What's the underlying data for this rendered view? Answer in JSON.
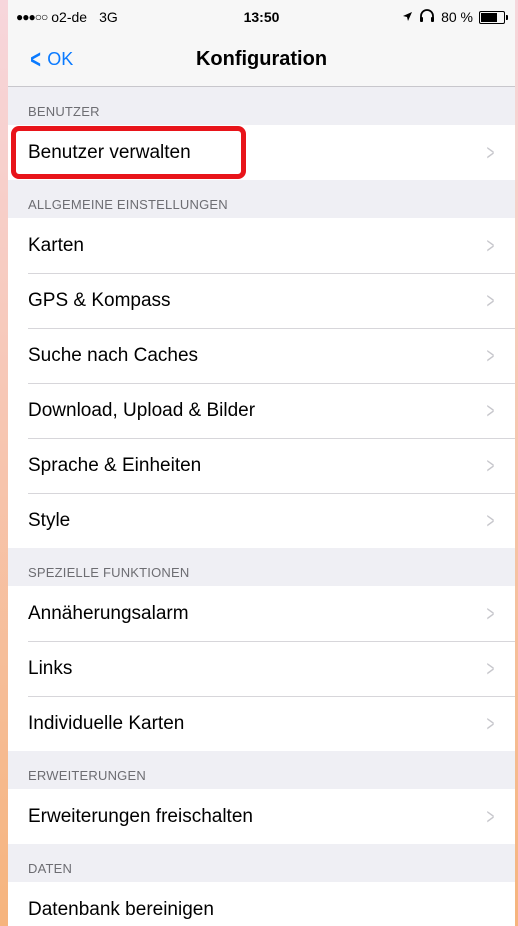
{
  "status_bar": {
    "signal_dots": "●●●○○",
    "carrier": "o2-de",
    "network": "3G",
    "time": "13:50",
    "location_icon": "location-arrow-icon",
    "headphones_icon": "headphones-icon",
    "battery_percent": "80 %",
    "battery_level": 0.8
  },
  "nav": {
    "back_label": "OK",
    "title": "Konfiguration"
  },
  "sections": [
    {
      "header": "BENUTZER",
      "items": [
        "Benutzer verwalten"
      ]
    },
    {
      "header": "ALLGEMEINE EINSTELLUNGEN",
      "items": [
        "Karten",
        "GPS & Kompass",
        "Suche nach Caches",
        "Download, Upload & Bilder",
        "Sprache & Einheiten",
        "Style"
      ]
    },
    {
      "header": "SPEZIELLE FUNKTIONEN",
      "items": [
        "Annäherungsalarm",
        "Links",
        "Individuelle Karten"
      ]
    },
    {
      "header": "ERWEITERUNGEN",
      "items": [
        "Erweiterungen freischalten"
      ]
    },
    {
      "header": "DATEN",
      "items": [
        "Datenbank bereinigen"
      ]
    }
  ],
  "highlight_color": "#e8141a",
  "accent_color": "#0a7aff"
}
